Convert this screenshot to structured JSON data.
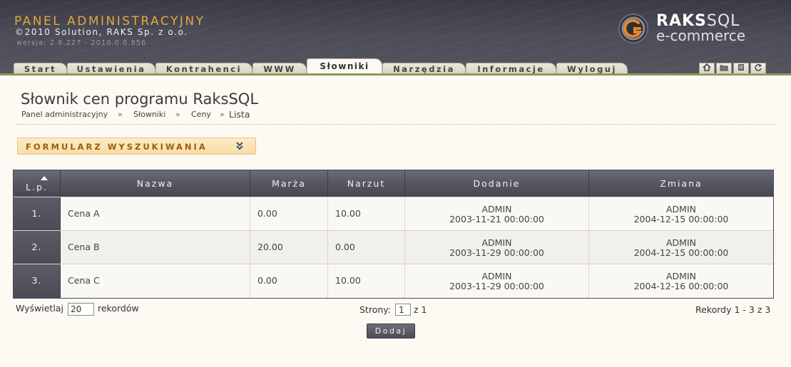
{
  "header": {
    "app_title": "PANEL ADMINISTRACYJNY",
    "copyright": "©2010 Solution, RAKS Sp. z o.o.",
    "version": "wersja: 2.6.227 - 2010.0.0.856",
    "logo_line1_bold": "RAKS",
    "logo_line1_light": "SQL",
    "logo_line2": "e-commerce"
  },
  "tabs": [
    {
      "label": "Start"
    },
    {
      "label": "Ustawienia"
    },
    {
      "label": "Kontrahenci"
    },
    {
      "label": "WWW"
    },
    {
      "label": "Słowniki",
      "active": true
    },
    {
      "label": "Narzędzia"
    },
    {
      "label": "Informacje"
    },
    {
      "label": "Wyloguj"
    }
  ],
  "toolbar_icons": [
    "home-icon",
    "folder-icon",
    "list-icon",
    "refresh-icon"
  ],
  "page": {
    "title": "Słownik cen programu RaksSQL",
    "breadcrumb": [
      "Panel administracyjny",
      "Słowniki",
      "Ceny",
      "Lista"
    ],
    "breadcrumb_sep": "»"
  },
  "search": {
    "label": "FORMULARZ WYSZUKIWANIA",
    "toggle": "¥"
  },
  "table": {
    "columns": [
      "L.p.",
      "Nazwa",
      "Marża",
      "Narzut",
      "Dodanie",
      "Zmiana"
    ],
    "rows": [
      {
        "lp": "1.",
        "name": "Cena A",
        "margin": "0.00",
        "markup": "10.00",
        "added_by": "ADMIN",
        "added_at": "2003-11-21 00:00:00",
        "changed_by": "ADMIN",
        "changed_at": "2004-12-15 00:00:00"
      },
      {
        "lp": "2.",
        "name": "Cena B",
        "margin": "20.00",
        "markup": "0.00",
        "added_by": "ADMIN",
        "added_at": "2003-11-29 00:00:00",
        "changed_by": "ADMIN",
        "changed_at": "2004-12-15 00:00:00"
      },
      {
        "lp": "3.",
        "name": "Cena C",
        "margin": "0.00",
        "markup": "10.00",
        "added_by": "ADMIN",
        "added_at": "2003-11-29 00:00:00",
        "changed_by": "ADMIN",
        "changed_at": "2004-12-16 00:00:00"
      }
    ]
  },
  "pagination": {
    "show_label": "Wyświetlaj",
    "per_page": "20",
    "records_label": "rekordów",
    "pages_label": "Strony:",
    "page_current": "1",
    "pages_total": "z 1",
    "records_info": "Rekordy 1 - 3 z 3"
  },
  "actions": {
    "add_label": "Dodaj"
  },
  "colors": {
    "accent": "#e6a63a",
    "header_bg": "#4c4c58",
    "tab_floor": "#8c9a5c",
    "search_bg": "#f8dca5"
  }
}
